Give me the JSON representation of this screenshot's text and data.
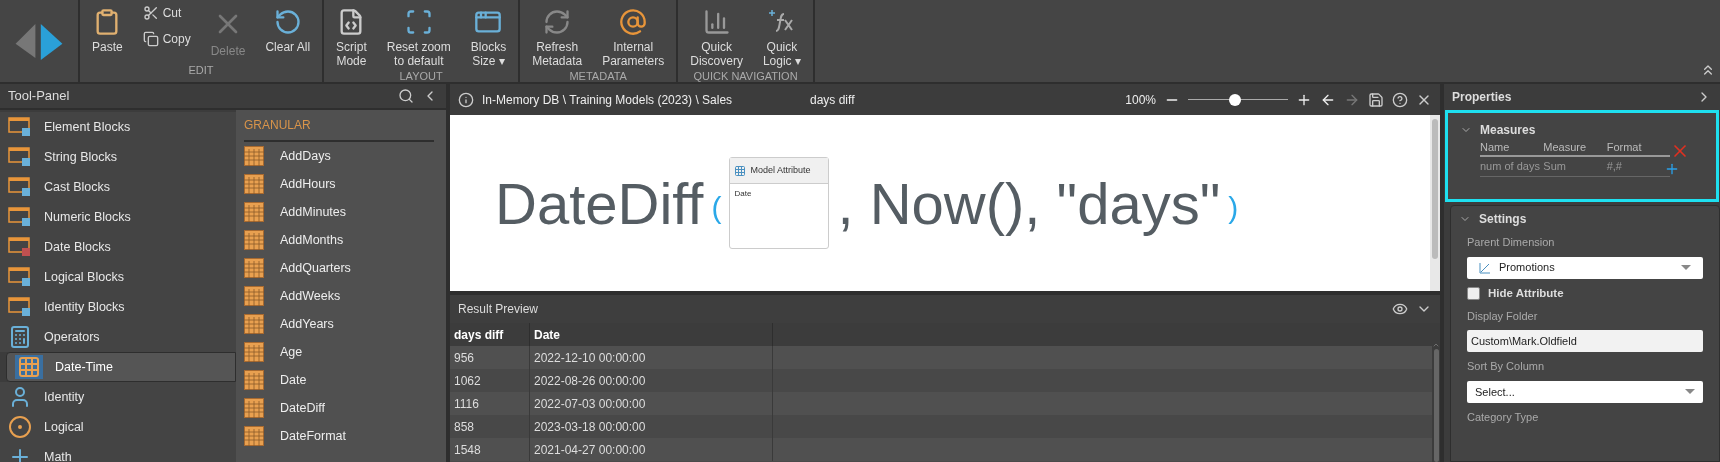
{
  "ribbon": {
    "groups": [
      {
        "title": "EDIT",
        "items": [
          {
            "kind": "paste",
            "lines": [
              "Paste"
            ],
            "disabled": false
          },
          {
            "kind": "cut",
            "lines": [
              "Cut"
            ],
            "disabled": false
          },
          {
            "kind": "copy",
            "lines": [
              "Copy"
            ],
            "disabled": false
          },
          {
            "kind": "delete",
            "lines": [
              "Delete"
            ],
            "disabled": true
          },
          {
            "kind": "clear",
            "lines": [
              "Clear All"
            ],
            "disabled": false
          }
        ]
      },
      {
        "title": "LAYOUT",
        "items": [
          {
            "kind": "script",
            "lines": [
              "Script",
              "Mode"
            ],
            "disabled": false
          },
          {
            "kind": "reset",
            "lines": [
              "Reset zoom",
              "to default"
            ],
            "disabled": false
          },
          {
            "kind": "blocks",
            "lines": [
              "Blocks",
              "Size ▾"
            ],
            "disabled": false
          }
        ]
      },
      {
        "title": "METADATA",
        "items": [
          {
            "kind": "refresh",
            "lines": [
              "Refresh",
              "Metadata"
            ],
            "disabled": false
          },
          {
            "kind": "at",
            "lines": [
              "Internal",
              "Parameters"
            ],
            "disabled": false
          }
        ]
      },
      {
        "title": "QUICK NAVIGATION",
        "items": [
          {
            "kind": "discovery",
            "lines": [
              "Quick",
              "Discovery"
            ],
            "disabled": false
          },
          {
            "kind": "fx",
            "lines": [
              "Quick",
              "Logic ▾"
            ],
            "disabled": false
          }
        ]
      }
    ]
  },
  "tool_panel": {
    "title": "Tool-Panel",
    "categories": [
      {
        "label": "Element Blocks",
        "kind": "element",
        "selected": false
      },
      {
        "label": "String Blocks",
        "kind": "string",
        "selected": false
      },
      {
        "label": "Cast Blocks",
        "kind": "cast",
        "selected": false
      },
      {
        "label": "Numeric Blocks",
        "kind": "numeric",
        "selected": false
      },
      {
        "label": "Date Blocks",
        "kind": "date",
        "selected": false
      },
      {
        "label": "Logical Blocks",
        "kind": "logicalblock",
        "selected": false
      },
      {
        "label": "Identity Blocks",
        "kind": "identityblock",
        "selected": false
      },
      {
        "label": "Operators",
        "kind": "operators",
        "selected": false
      },
      {
        "label": "Date-Time",
        "kind": "datetime",
        "selected": true
      },
      {
        "label": "Identity",
        "kind": "identity",
        "selected": false
      },
      {
        "label": "Logical",
        "kind": "logical",
        "selected": false
      },
      {
        "label": "Math",
        "kind": "math",
        "selected": false
      }
    ],
    "section": "GRANULAR",
    "functions": [
      "AddDays",
      "AddHours",
      "AddMinutes",
      "AddMonths",
      "AddQuarters",
      "AddWeeks",
      "AddYears",
      "Age",
      "Date",
      "DateDiff",
      "DateFormat"
    ]
  },
  "editor": {
    "path": "In-Memory DB \\ Training Models (2023) \\ Sales",
    "title": "days diff",
    "zoom": "100%",
    "zoom_slider": {
      "level": 0.47
    },
    "formula": {
      "function": "DateDiff",
      "open": "(",
      "block_title": "Model Attribute",
      "block_value": "Date",
      "rest": ", Now(), \"days\"",
      "close": ")"
    }
  },
  "result_preview": {
    "title": "Result Preview",
    "columns": [
      "days diff",
      "Date"
    ],
    "rows": [
      [
        "956",
        "2022-12-10 00:00:00"
      ],
      [
        "1062",
        "2022-08-26 00:00:00"
      ],
      [
        "1116",
        "2022-07-03 00:00:00"
      ],
      [
        "858",
        "2023-03-18 00:00:00"
      ],
      [
        "1548",
        "2021-04-27 00:00:00"
      ]
    ]
  },
  "properties": {
    "title": "Properties",
    "measures": {
      "title": "Measures",
      "columns": [
        "Name",
        "Measure",
        "Format"
      ],
      "rows": [
        [
          "num of days",
          "Sum",
          "#,#"
        ]
      ]
    },
    "settings": {
      "title": "Settings",
      "parent_dimension_label": "Parent Dimension",
      "parent_dimension": "Promotions",
      "hide_attribute": {
        "label": "Hide Attribute",
        "checked": false
      },
      "display_folder_label": "Display Folder",
      "display_folder": "Custom\\Mark.Oldfield",
      "sort_by_label": "Sort By Column",
      "sort_by_placeholder": "Select...",
      "category_type_label": "Category Type"
    }
  }
}
